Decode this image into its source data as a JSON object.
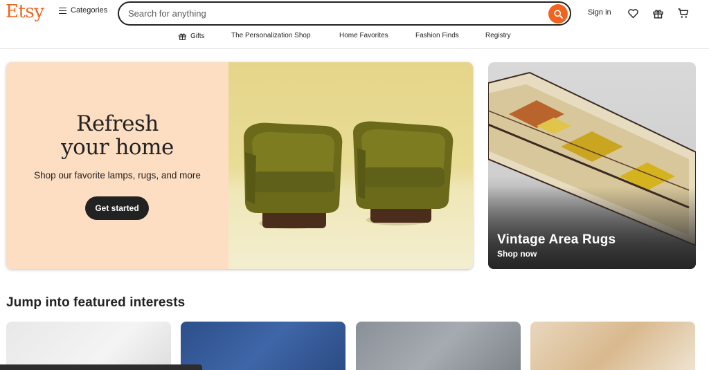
{
  "header": {
    "logo": "Etsy",
    "categories_label": "Categories",
    "search_placeholder": "Search for anything",
    "signin_label": "Sign in"
  },
  "nav": {
    "items": [
      "Gifts",
      "The Personalization Shop",
      "Home Favorites",
      "Fashion Finds",
      "Registry"
    ]
  },
  "hero": {
    "title_line1": "Refresh",
    "title_line2": "your home",
    "subtitle": "Shop our favorite lamps, rugs, and more",
    "cta": "Get started"
  },
  "side_card": {
    "title": "Vintage Area Rugs",
    "subtitle": "Shop now"
  },
  "featured": {
    "title": "Jump into featured interests"
  },
  "icons": {
    "search": "search-icon",
    "menu": "menu-icon",
    "favorites": "heart-icon",
    "gifts": "gift-icon",
    "cart": "cart-icon"
  },
  "colors": {
    "brand": "#F1641E",
    "hero_bg": "#FDDEC3",
    "text": "#222222"
  }
}
